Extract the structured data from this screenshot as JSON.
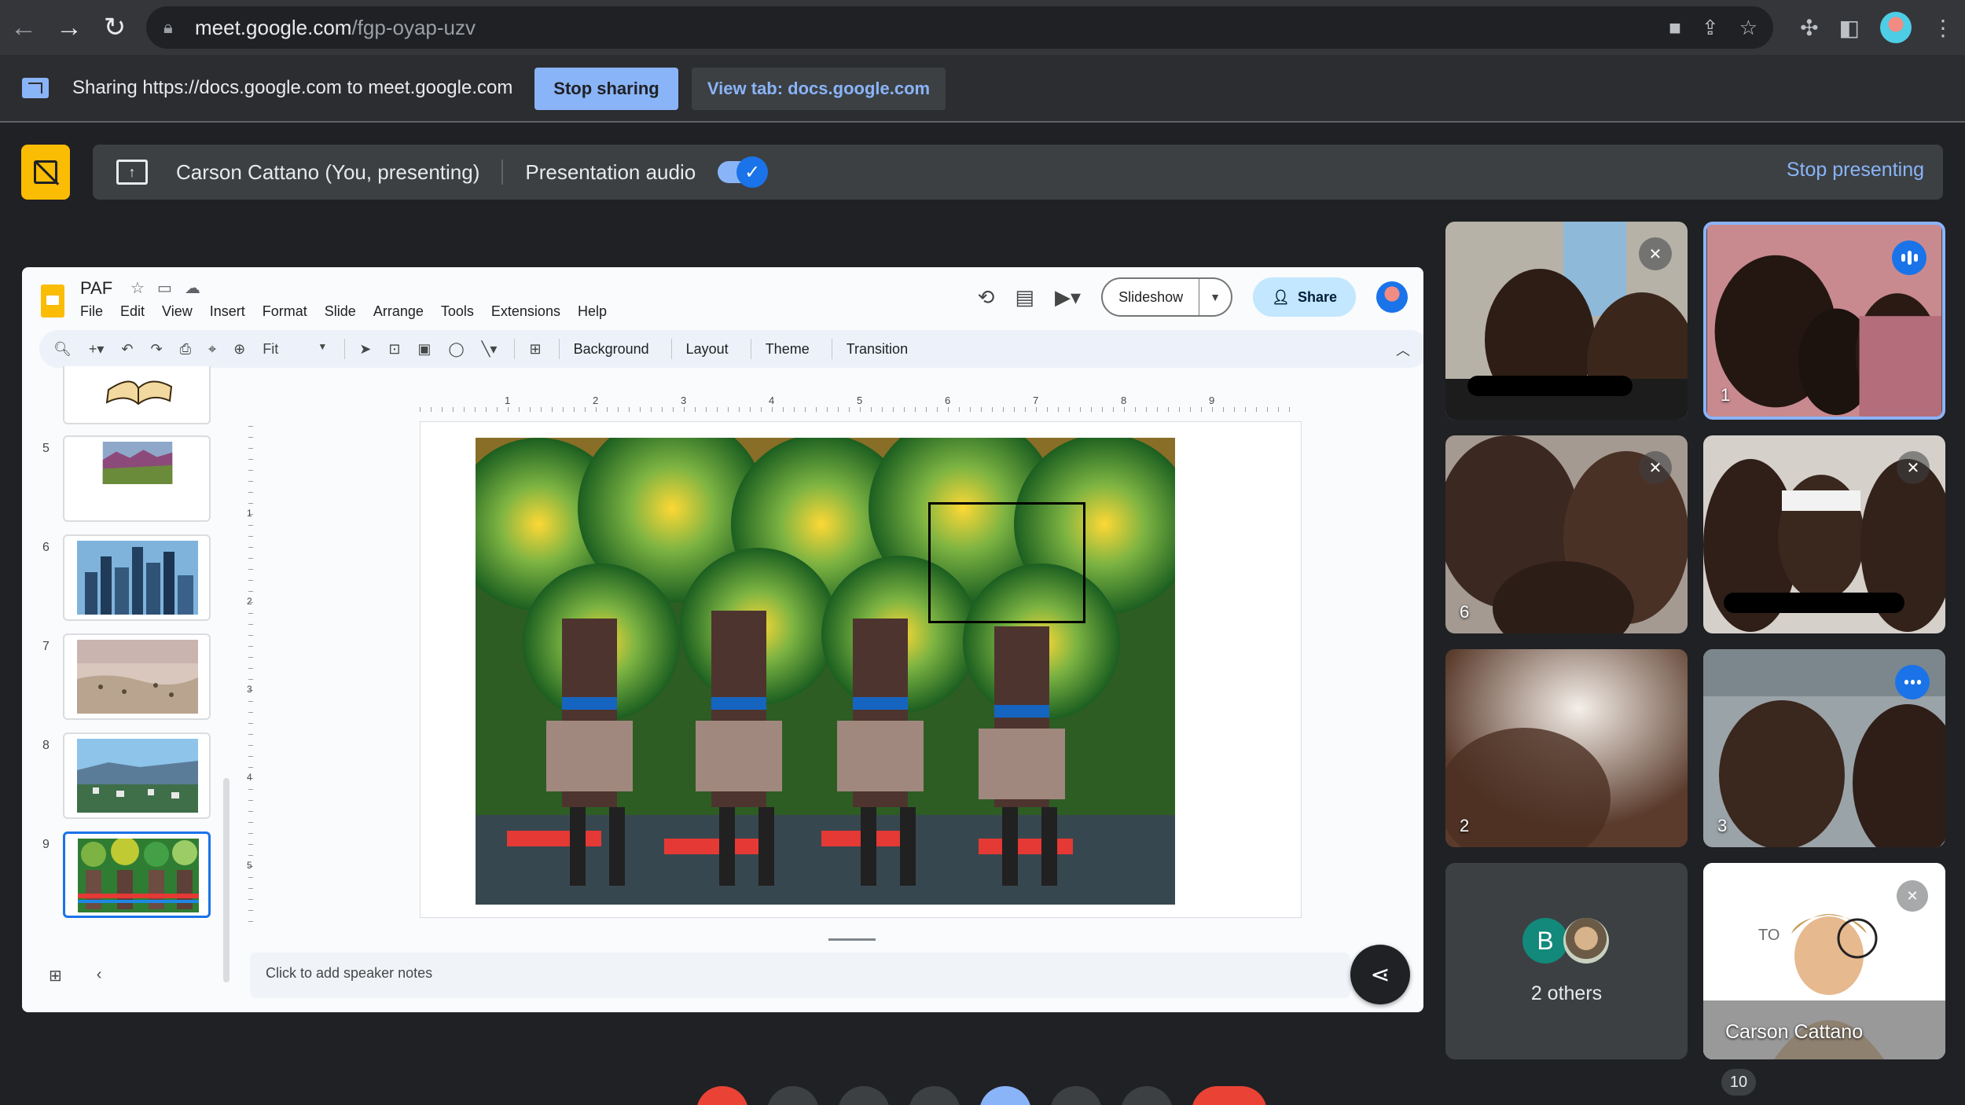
{
  "browser": {
    "url_host": "meet.google.com",
    "url_path": "/fgp-oyap-uzv"
  },
  "share_bar": {
    "text": "Sharing https://docs.google.com to meet.google.com",
    "stop_label": "Stop sharing",
    "view_tab_label": "View tab: docs.google.com"
  },
  "present_bar": {
    "presenter": "Carson Cattano (You, presenting)",
    "audio_label": "Presentation audio",
    "audio_on": true,
    "stop_label": "Stop presenting"
  },
  "slides": {
    "doc_title": "PAF",
    "menu": [
      "File",
      "Edit",
      "View",
      "Insert",
      "Format",
      "Slide",
      "Arrange",
      "Tools",
      "Extensions",
      "Help"
    ],
    "slideshow_label": "Slideshow",
    "share_label": "Share",
    "toolbar": {
      "zoom": "Fit",
      "background": "Background",
      "layout": "Layout",
      "theme": "Theme",
      "transition": "Transition"
    },
    "ruler_h": [
      "1",
      "2",
      "3",
      "4",
      "5",
      "6",
      "7",
      "8",
      "9"
    ],
    "ruler_v": [
      "1",
      "2",
      "3",
      "4",
      "5"
    ],
    "thumbnails": [
      {
        "num": "5"
      },
      {
        "num": "6"
      },
      {
        "num": "7"
      },
      {
        "num": "8"
      },
      {
        "num": "9",
        "active": true
      }
    ],
    "notes_placeholder": "Click to add speaker notes"
  },
  "participants": {
    "tiles": [
      {
        "label": "",
        "muted": true
      },
      {
        "label": "1",
        "speaking": true
      },
      {
        "label": "6",
        "muted": true
      },
      {
        "label": "",
        "muted": true
      },
      {
        "label": "2"
      },
      {
        "label": "3",
        "speaking": true
      }
    ],
    "others": {
      "avatar_letter": "B",
      "text": "2 others"
    },
    "self": {
      "name": "Carson Cattano",
      "muted": true
    }
  },
  "controls": {
    "participant_count": "10"
  },
  "colors": {
    "accent": "#8ab4f8",
    "slides_yellow": "#fbbc04",
    "meet_bg": "#202124",
    "leave_red": "#ea4335"
  }
}
